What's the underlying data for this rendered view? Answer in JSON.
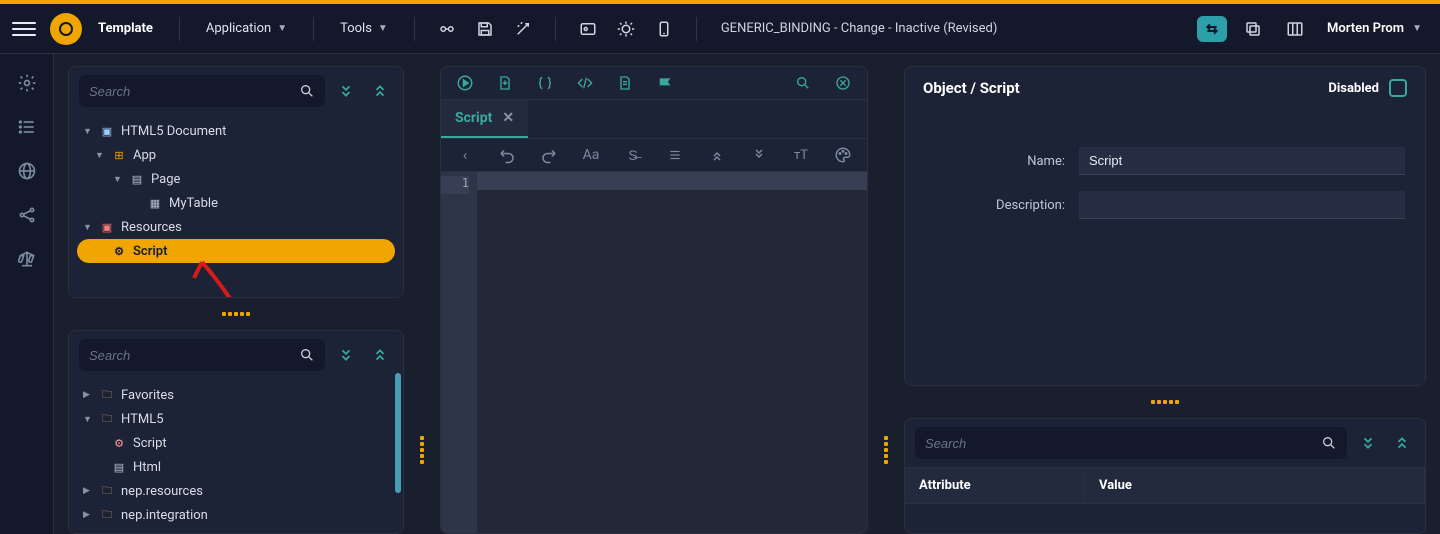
{
  "topbar": {
    "template_label": "Template",
    "menus": {
      "application": "Application",
      "tools": "Tools"
    },
    "document_title": "GENERIC_BINDING - Change - Inactive (Revised)",
    "user_name": "Morten Prom"
  },
  "left_panel_top": {
    "search_placeholder": "Search",
    "tree": {
      "root": "HTML5 Document",
      "app": "App",
      "page": "Page",
      "mytable": "MyTable",
      "resources": "Resources",
      "script": "Script"
    }
  },
  "left_panel_bottom": {
    "search_placeholder": "Search",
    "tree": {
      "favorites": "Favorites",
      "html5": "HTML5",
      "script": "Script",
      "html": "Html",
      "nep_resources": "nep.resources",
      "nep_integration": "nep.integration"
    }
  },
  "editor": {
    "tab_label": "Script",
    "line_number": "1"
  },
  "properties": {
    "heading": "Object / Script",
    "disabled_label": "Disabled",
    "name_label": "Name:",
    "name_value": "Script",
    "desc_label": "Description:",
    "desc_value": ""
  },
  "attr_panel": {
    "search_placeholder": "Search",
    "columns": {
      "attribute": "Attribute",
      "value": "Value"
    }
  }
}
